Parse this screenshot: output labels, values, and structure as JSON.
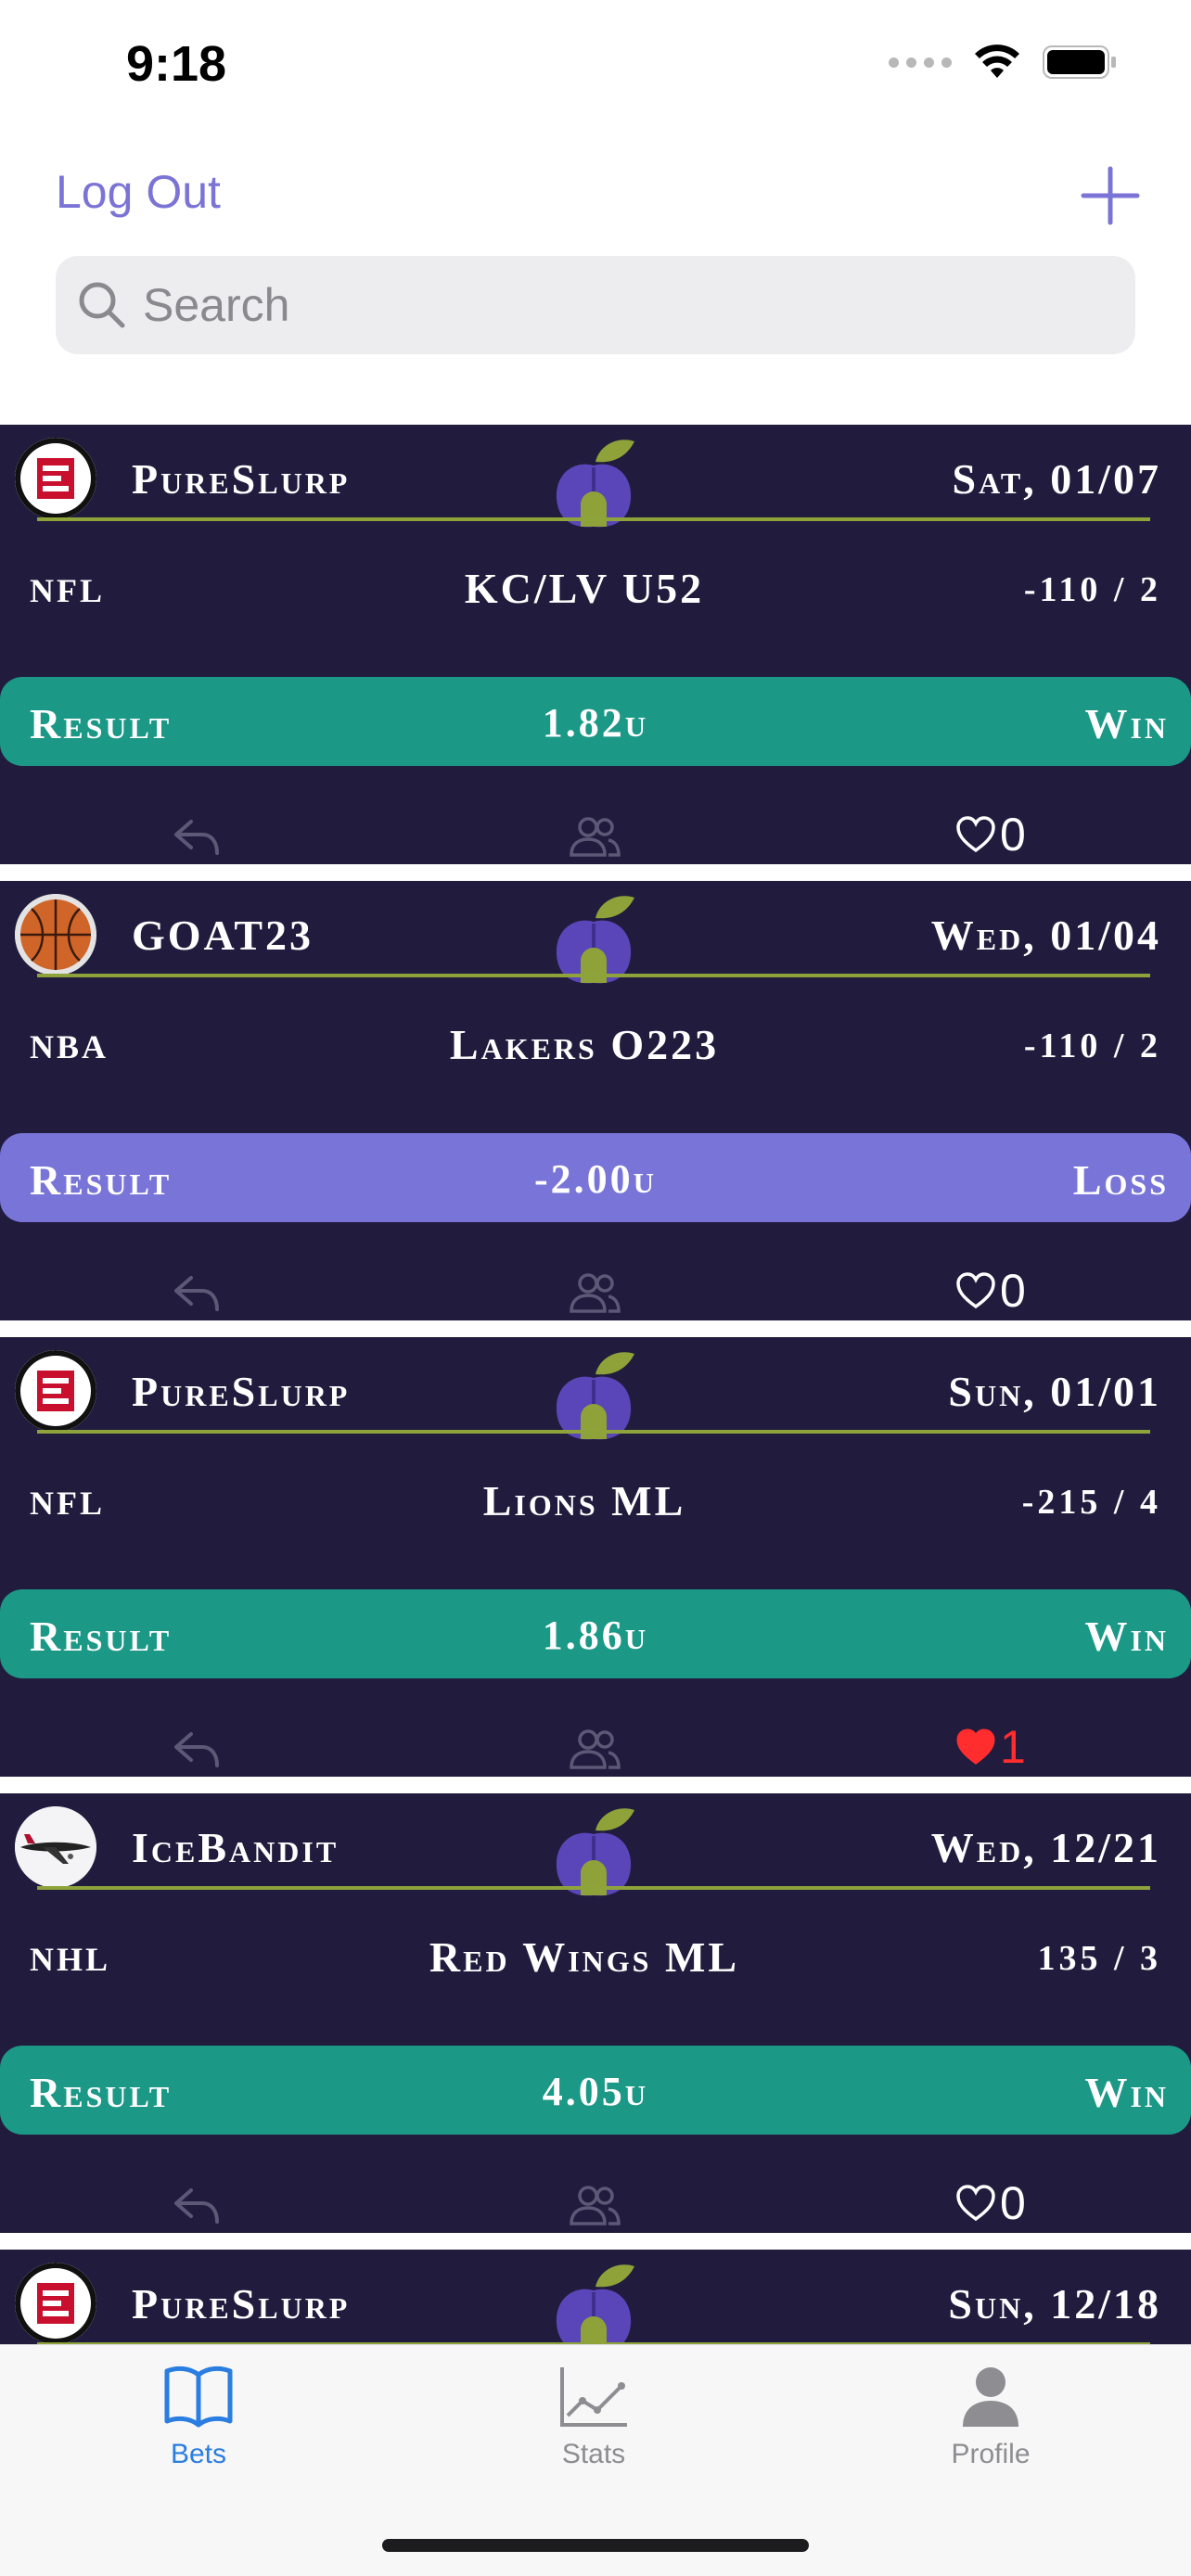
{
  "status_bar": {
    "time": "9:18"
  },
  "header": {
    "logout_label": "Log Out"
  },
  "search": {
    "placeholder": "Search"
  },
  "feed": [
    {
      "username": "PureSlurp",
      "avatar": "espn-logo",
      "date": "Sat, 01/07",
      "league": "NFL",
      "pick": "KC/LV U52",
      "odds": "-110 / 2",
      "result_label": "Result",
      "units": "1.82u",
      "outcome": "Win",
      "likes": "0",
      "liked": false
    },
    {
      "username": "GOAT23",
      "avatar": "basketball",
      "date": "Wed, 01/04",
      "league": "NBA",
      "pick": "Lakers O223",
      "odds": "-110 / 2",
      "result_label": "Result",
      "units": "-2.00u",
      "outcome": "Loss",
      "likes": "0",
      "liked": false
    },
    {
      "username": "PureSlurp",
      "avatar": "espn-logo",
      "date": "Sun, 01/01",
      "league": "NFL",
      "pick": "Lions ML",
      "odds": "-215 / 4",
      "result_label": "Result",
      "units": "1.86u",
      "outcome": "Win",
      "likes": "1",
      "liked": true
    },
    {
      "username": "IceBandit",
      "avatar": "airplane",
      "date": "Wed, 12/21",
      "league": "NHL",
      "pick": "Red Wings ML",
      "odds": "135 / 3",
      "result_label": "Result",
      "units": "4.05u",
      "outcome": "Win",
      "likes": "0",
      "liked": false
    },
    {
      "username": "PureSlurp",
      "avatar": "espn-logo",
      "date": "Sun, 12/18"
    }
  ],
  "tabs": [
    {
      "label": "Bets",
      "icon": "book-icon",
      "active": true
    },
    {
      "label": "Stats",
      "icon": "chart-icon",
      "active": false
    },
    {
      "label": "Profile",
      "icon": "person-icon",
      "active": false
    }
  ],
  "colors": {
    "accent": "#7b74d6",
    "card_bg": "#211b3d",
    "win": "#1b9886",
    "loss": "#7975d8",
    "liked": "#ff2d2d",
    "tab_active": "#2a7de1"
  }
}
